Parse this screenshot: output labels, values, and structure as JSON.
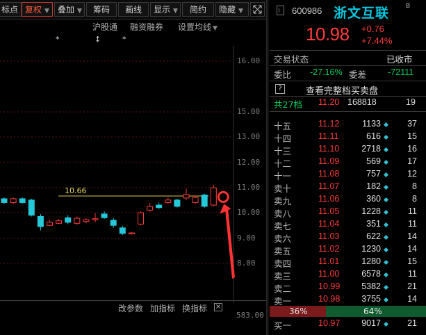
{
  "toolbar": {
    "items": [
      {
        "label": "标点",
        "dropdown": false,
        "active": false
      },
      {
        "label": "复权",
        "dropdown": true,
        "active": true
      },
      {
        "label": "叠加",
        "dropdown": true,
        "active": false
      },
      {
        "label": "筹码",
        "dropdown": false,
        "active": false
      },
      {
        "label": "画线",
        "dropdown": false,
        "active": false
      },
      {
        "label": "显示",
        "dropdown": true,
        "active": false
      },
      {
        "label": "简约",
        "dropdown": false,
        "active": false
      },
      {
        "label": "隐藏",
        "dropdown": true,
        "active": false
      }
    ],
    "expand_icon": "expand-icon"
  },
  "subbar": {
    "hgt": "沪股通",
    "margin": "融资融券",
    "ma_settings": "设置均线"
  },
  "markers": [
    "*",
    "↕",
    "*"
  ],
  "chart": {
    "y_ticks": [
      "16.00",
      "15.00",
      "13.00",
      "12.00",
      "11.00",
      "10.00",
      "9.00",
      "8.00"
    ],
    "price_line_label": "10.66",
    "candles": [
      {
        "o": 10.55,
        "c": 10.4,
        "h": 10.6,
        "l": 10.35
      },
      {
        "o": 10.4,
        "c": 10.55,
        "h": 10.6,
        "l": 10.35
      },
      {
        "o": 10.55,
        "c": 10.4,
        "h": 10.6,
        "l": 10.35
      },
      {
        "o": 10.5,
        "c": 9.9,
        "h": 10.55,
        "l": 9.85
      },
      {
        "o": 9.85,
        "c": 9.45,
        "h": 9.95,
        "l": 9.3
      },
      {
        "o": 9.5,
        "c": 9.62,
        "h": 9.7,
        "l": 9.48
      },
      {
        "o": 9.58,
        "c": 9.68,
        "h": 9.75,
        "l": 9.55
      },
      {
        "o": 9.8,
        "c": 9.62,
        "h": 9.9,
        "l": 9.55
      },
      {
        "o": 9.58,
        "c": 9.78,
        "h": 9.85,
        "l": 9.52
      },
      {
        "o": 9.65,
        "c": 9.72,
        "h": 9.78,
        "l": 9.58
      },
      {
        "o": 9.72,
        "c": 9.76,
        "h": 9.98,
        "l": 9.62
      },
      {
        "o": 9.95,
        "c": 9.8,
        "h": 10.05,
        "l": 9.75
      },
      {
        "o": 9.7,
        "c": 9.5,
        "h": 9.78,
        "l": 9.4
      },
      {
        "o": 9.4,
        "c": 9.18,
        "h": 9.48,
        "l": 9.12
      },
      {
        "o": 9.16,
        "c": 9.2,
        "h": 9.24,
        "l": 9.14
      },
      {
        "o": 9.55,
        "c": 10.0,
        "h": 10.05,
        "l": 9.5
      },
      {
        "o": 10.1,
        "c": 10.25,
        "h": 10.38,
        "l": 10.05
      },
      {
        "o": 10.3,
        "c": 10.2,
        "h": 10.4,
        "l": 10.15
      },
      {
        "o": 10.4,
        "c": 10.5,
        "h": 10.6,
        "l": 10.35
      },
      {
        "o": 10.5,
        "c": 10.25,
        "h": 10.55,
        "l": 10.2
      },
      {
        "o": 10.58,
        "c": 10.72,
        "h": 10.95,
        "l": 10.5
      },
      {
        "o": 10.4,
        "c": 10.6,
        "h": 10.68,
        "l": 10.35
      },
      {
        "o": 10.7,
        "c": 10.25,
        "h": 10.75,
        "l": 10.2
      },
      {
        "o": 10.3,
        "c": 10.98,
        "h": 11.1,
        "l": 10.25
      }
    ]
  },
  "bottombar": {
    "change_params": "改参数",
    "add_indicator": "加指标",
    "switch_indicator": "换指标",
    "close_icon": "×",
    "vol_axis": "583.00"
  },
  "quote": {
    "code": "600986",
    "name": "浙文互联",
    "badge": "B",
    "price": "10.98",
    "change": "+0.76",
    "change_pct": "+7.44%",
    "status_label": "交易状态",
    "status_value": "已收市",
    "wb_label": "委比",
    "wb_value": "-27.16%",
    "wc_label": "委差",
    "wc_value": "-72111",
    "full_book_label": "查看完整档买卖盘",
    "summary": {
      "label": "共27档",
      "price": "11.20",
      "vol": "168818",
      "count": "19"
    },
    "asks": [
      {
        "label": "十五",
        "price": "11.12",
        "vol": "1133",
        "count": "37"
      },
      {
        "label": "十四",
        "price": "11.11",
        "vol": "616",
        "count": "15"
      },
      {
        "label": "十三",
        "price": "11.10",
        "vol": "2718",
        "count": "16"
      },
      {
        "label": "十二",
        "price": "11.09",
        "vol": "569",
        "count": "17"
      },
      {
        "label": "十一",
        "price": "11.08",
        "vol": "757",
        "count": "12"
      },
      {
        "label": "卖十",
        "price": "11.07",
        "vol": "182",
        "count": "8"
      },
      {
        "label": "卖九",
        "price": "11.06",
        "vol": "360",
        "count": "8"
      },
      {
        "label": "卖八",
        "price": "11.05",
        "vol": "1228",
        "count": "11"
      },
      {
        "label": "卖七",
        "price": "11.04",
        "vol": "351",
        "count": "11"
      },
      {
        "label": "卖六",
        "price": "11.03",
        "vol": "622",
        "count": "14"
      },
      {
        "label": "卖五",
        "price": "11.02",
        "vol": "1230",
        "count": "14"
      },
      {
        "label": "卖四",
        "price": "11.01",
        "vol": "1280",
        "count": "15"
      },
      {
        "label": "卖三",
        "price": "11.00",
        "vol": "6578",
        "count": "11"
      },
      {
        "label": "卖二",
        "price": "10.99",
        "vol": "5382",
        "count": "21"
      },
      {
        "label": "卖一",
        "price": "10.98",
        "vol": "3755",
        "count": "14"
      }
    ],
    "ratio": {
      "buy": "36%",
      "sell": "64%",
      "buy_fraction": 0.36
    },
    "bids": [
      {
        "label": "买一",
        "price": "10.97",
        "vol": "9017",
        "count": "21"
      }
    ]
  }
}
